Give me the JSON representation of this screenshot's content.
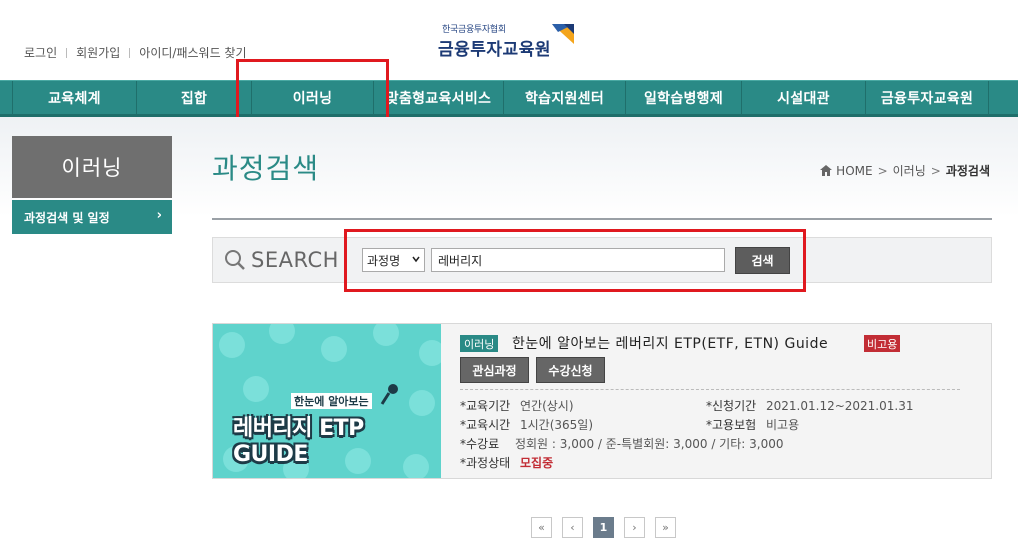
{
  "top_links": [
    "로그인",
    "회원가입",
    "아이디/패스워드 찾기"
  ],
  "logo": {
    "small": "한국금융투자협회",
    "big": "금융투자교육원"
  },
  "nav": [
    "교육체계",
    "집합",
    "이러닝",
    "맞춤형교육서비스",
    "학습지원센터",
    "일학습병행제",
    "시설대관",
    "금융투자교육원"
  ],
  "sidebar": {
    "title": "이러닝",
    "item": "과정검색 및 일정",
    "chevron": "›"
  },
  "page": {
    "title": "과정검색"
  },
  "breadcrumb": {
    "home": "HOME",
    "level1": "이러닝",
    "current": "과정검색",
    "sep": ">"
  },
  "search": {
    "label": "SEARCH",
    "select_value": "과정명",
    "input_value": "레버리지",
    "button": "검색"
  },
  "course": {
    "thumb_sub": "한눈에 알아보는",
    "thumb_main": "레버리지 ETP GUIDE",
    "category": "이러닝",
    "title": "한눈에 알아보는 레버리지 ETP(ETF, ETN) Guide",
    "employment": "비고용",
    "btn_interest": "관심과정",
    "btn_apply": "수강신청",
    "period_label": "*교육기간",
    "period_value": "연간(상시)",
    "apply_label": "*신청기간",
    "apply_value": "2021.01.12~2021.01.31",
    "hours_label": "*교육시간",
    "hours_value": "1시간(365일)",
    "insurance_label": "*고용보험",
    "insurance_value": "비고용",
    "fee_label": "*수강료",
    "fee_value": "정회원 : 3,000 / 준-특별회원: 3,000 / 기타: 3,000",
    "status_label": "*과정상태",
    "status_value": "모집중"
  },
  "pagination": {
    "first": "«",
    "prev": "‹",
    "current": "1",
    "next": "›",
    "last": "»"
  },
  "colors": {
    "teal": "#2a8a86",
    "highlight_red": "#e0191f",
    "status_red": "#c22d35"
  }
}
